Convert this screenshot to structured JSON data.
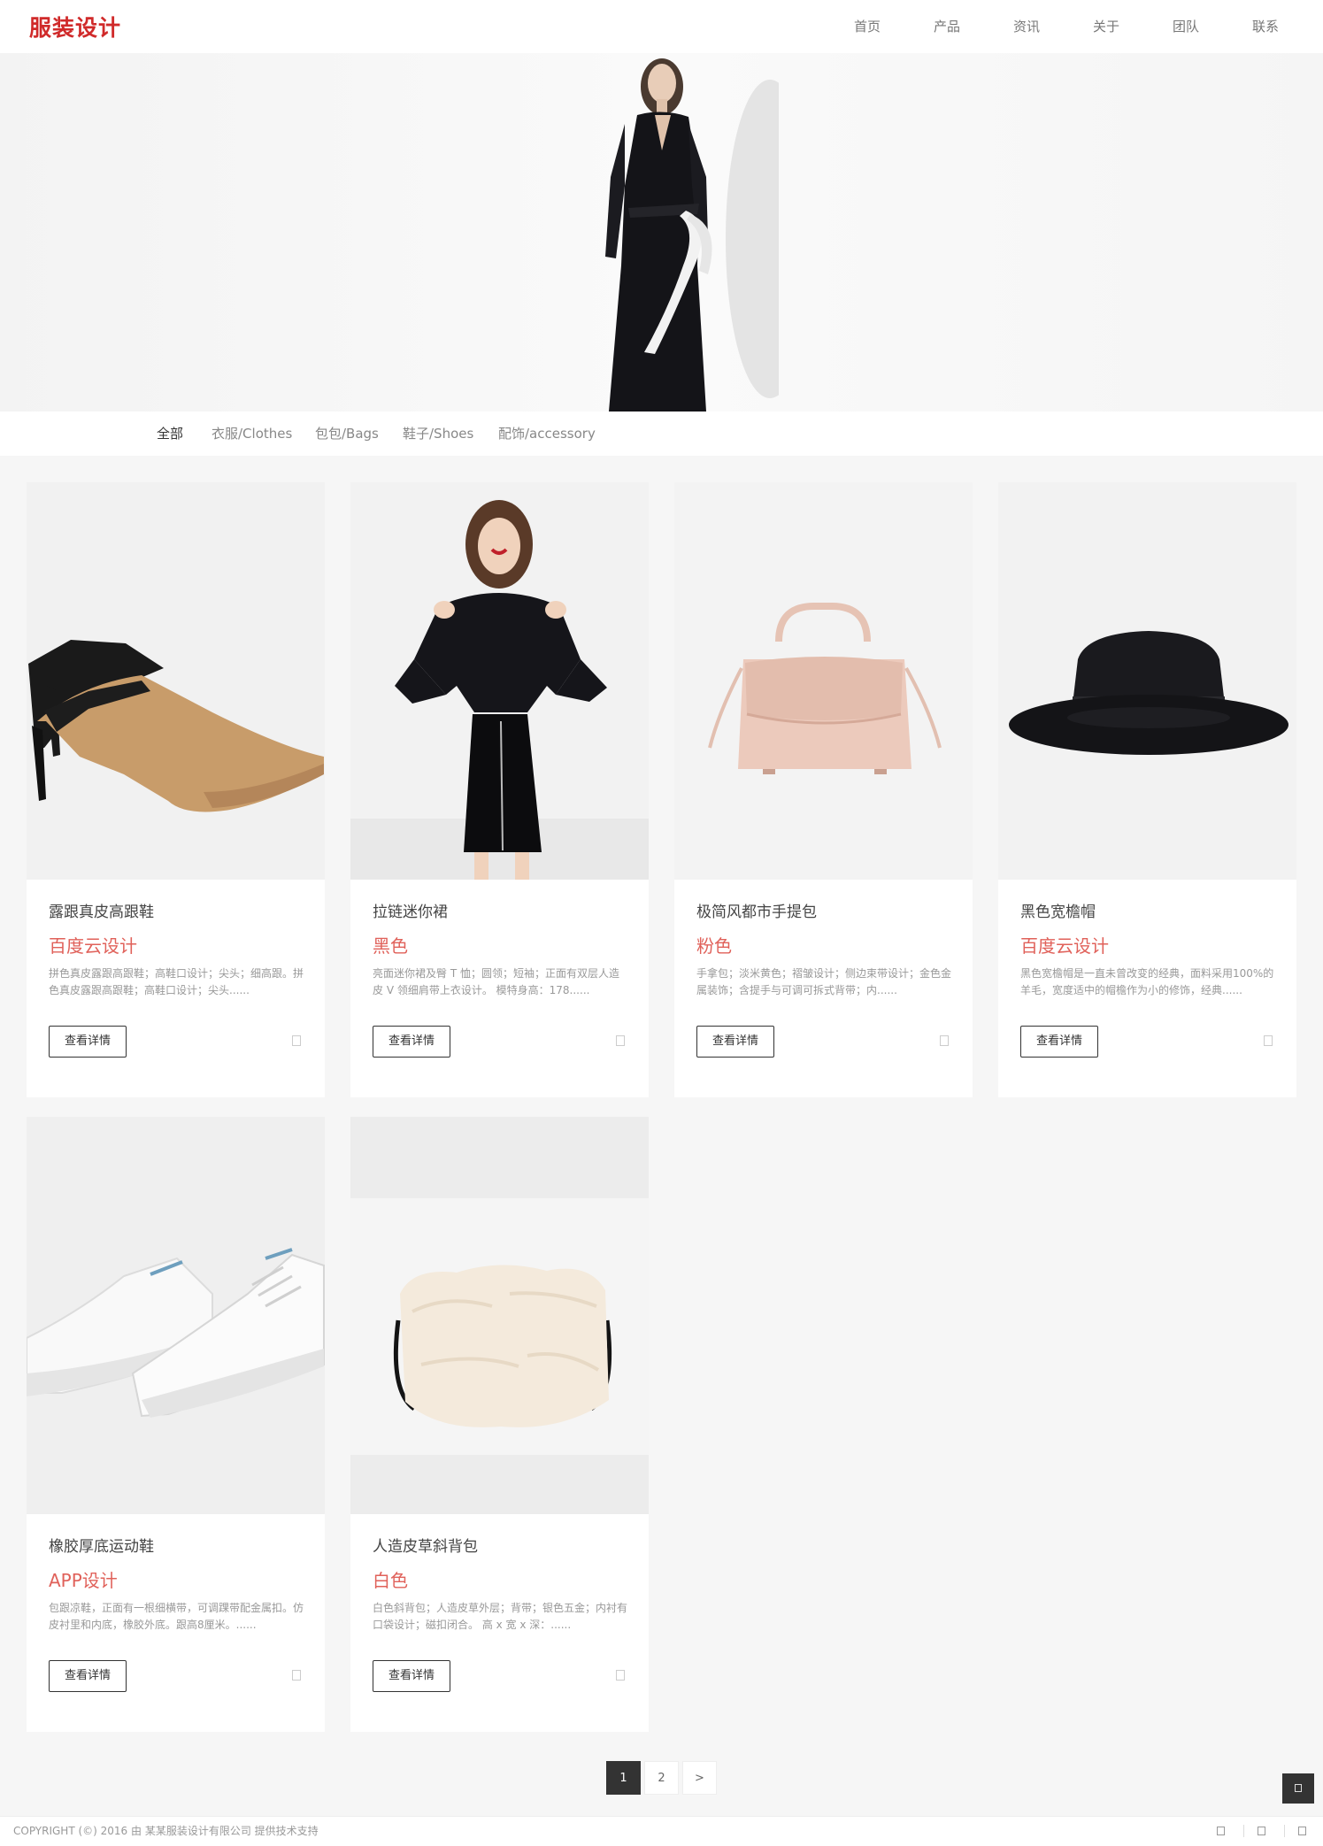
{
  "header": {
    "logo": "服装设计",
    "nav": [
      "首页",
      "产品",
      "资讯",
      "关于",
      "团队",
      "联系"
    ]
  },
  "filter": {
    "items": [
      "全部",
      "衣服/Clothes",
      "包包/Bags",
      "鞋子/Shoes",
      "配饰/accessory"
    ],
    "active": "全部"
  },
  "products": [
    {
      "name": "露跟真皮高跟鞋",
      "sub": "百度云设计",
      "desc": "拼色真皮露跟高跟鞋；高鞋口设计；尖头；细高跟。拼色真皮露跟高跟鞋；高鞋口设计；尖头......",
      "button": "查看详情",
      "image_icon": "heels-icon"
    },
    {
      "name": "拉链迷你裙",
      "sub": "黑色",
      "desc": "亮面迷你裙及臀 T 恤；圆领；短袖；正面有双层人造皮 V 领细肩带上衣设计。 模特身高：178......",
      "button": "查看详情",
      "image_icon": "model-icon"
    },
    {
      "name": "极简风都市手提包",
      "sub": "粉色",
      "desc": "手拿包；淡米黄色；褶皱设计；侧边束带设计；金色金属装饰；含提手与可调可拆式背带；内......",
      "button": "查看详情",
      "image_icon": "handbag-icon"
    },
    {
      "name": "黑色宽檐帽",
      "sub": "百度云设计",
      "desc": "黑色宽檐帽是一直未曾改变的经典，面料采用100%的羊毛，宽度适中的帽檐作为小的修饰，经典......",
      "button": "查看详情",
      "image_icon": "hat-icon"
    },
    {
      "name": "橡胶厚底运动鞋",
      "sub": "APP设计",
      "desc": "包跟凉鞋，正面有一根细横带，可调踝带配金属扣。仿皮衬里和内底，橡胶外底。跟高8厘米。......",
      "button": "查看详情",
      "image_icon": "sneakers-icon"
    },
    {
      "name": "人造皮草斜背包",
      "sub": "白色",
      "desc": "白色斜背包；人造皮草外层；背带；银色五金；内衬有口袋设计；磁扣闭合。 高 x 宽 x 深：......",
      "button": "查看详情",
      "image_icon": "fur-bag-icon"
    }
  ],
  "pagination": {
    "pages": [
      "1",
      "2",
      ">"
    ],
    "current": "1"
  },
  "footer": {
    "copyright": "COPYRIGHT (©) 2016 由 某某服装设计有限公司 提供技术支持"
  },
  "colors": {
    "logo": "#d02a2a",
    "accent": "#e0615a",
    "background": "#f6f6f6"
  }
}
